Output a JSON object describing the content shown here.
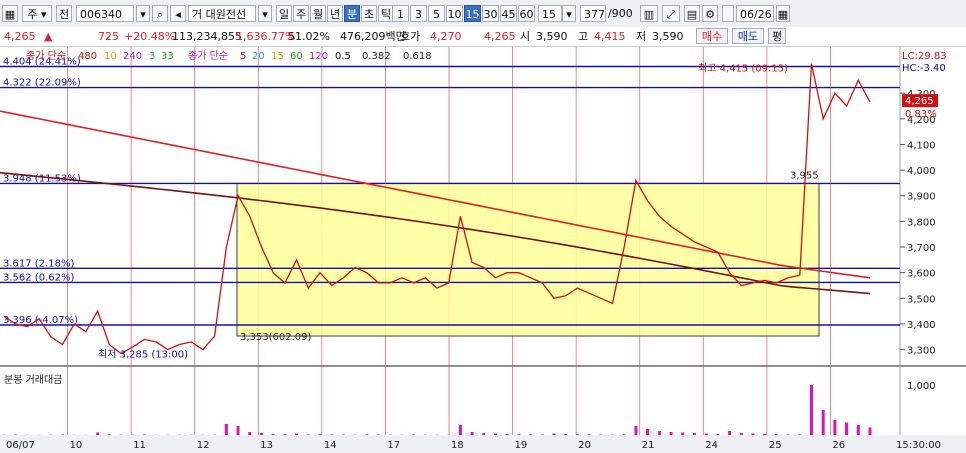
{
  "toolbar": {
    "mode_select": "주",
    "market_select": "전",
    "code": "006340",
    "name": "거 대원전선",
    "period_tabs": [
      "일",
      "주",
      "월",
      "년",
      "분",
      "초",
      "틱"
    ],
    "active_period": "분",
    "intervals": [
      "1",
      "3",
      "5",
      "10",
      "15",
      "30",
      "45",
      "60"
    ],
    "active_interval": "15",
    "interval_input": "15",
    "count": "377",
    "count_total": "/900",
    "date": "06/26"
  },
  "quote": {
    "price": "4,265",
    "arrow": "▲",
    "change": "725",
    "change_pct": "+20.48%",
    "volume": "113,234,855",
    "volume_ratio": "1,636.77%",
    "turnover": "51.02%",
    "amount": "476,209백만",
    "hoga_label": "호가",
    "hoga_ask": "4,270",
    "hoga_bid": "4,265",
    "open_label": "시",
    "open": "3,590",
    "high_label": "고",
    "high": "4,415",
    "low_label": "저",
    "low": "3,590",
    "buy_button": "매수",
    "sell_button": "매도",
    "eval_button": "평"
  },
  "legend": {
    "price_ma_label": "종가 단순",
    "price_ma_periods": [
      "480",
      "10",
      "240",
      "3",
      "33"
    ],
    "volume_ma_label": "종가 단순",
    "volume_ma_periods": [
      "5",
      "20",
      "15",
      "60",
      "120"
    ],
    "fib_values": [
      "0.5",
      "0.382",
      "0.618"
    ],
    "lc_label": "LC:29.83",
    "hc_label": "HC:-3.40"
  },
  "annotations": {
    "level_labels": [
      "4.404 (24.41%)",
      "4.322 (22.09%)",
      "3.948 (11.53%)",
      "3.617 (2.18%)",
      "3.562 (0.62%)",
      "3.396 (-4.07%)"
    ],
    "high_mark": "최고 4,415 (09:15)",
    "low_mark": "최저 3,285 (13:00)",
    "base_mark": "3,353(602.09)",
    "box_top_mark": "3,955",
    "current_price_tag": "4,265",
    "current_pct_tag": "0.83%"
  },
  "volume_pane": {
    "title": "분봉 거래대금",
    "axis_label": "1,000"
  },
  "colors": {
    "price_line": "#d01010",
    "ma_long": "#e02020",
    "ma_long2": "#7a1010",
    "hline": "#1010b0",
    "box_fill": "#ffff99",
    "volume_bar": "#e010c0",
    "grid_vline": "#e03030"
  },
  "chart_data": {
    "type": "line",
    "title": "",
    "x_ticks": [
      "06/07",
      "10",
      "11",
      "12",
      "13",
      "14",
      "17",
      "18",
      "19",
      "20",
      "21",
      "24",
      "25",
      "26",
      "15:30:00"
    ],
    "y_ticks": [
      4300,
      4200,
      4100,
      4000,
      3900,
      3800,
      3700,
      3600,
      3500,
      3400,
      3300
    ],
    "ylim": [
      3240,
      4480
    ],
    "horizontal_levels": [
      4404,
      4322,
      3948,
      3617,
      3562,
      3396
    ],
    "series": [
      {
        "values": [
          3430,
          3400,
          3390,
          3420,
          3350,
          3320,
          3400,
          3370,
          3450,
          3320,
          3285,
          3310,
          3340,
          3330,
          3300,
          3320,
          3330,
          3300,
          3353,
          3700,
          3900,
          3820,
          3700,
          3600,
          3560,
          3650,
          3540,
          3600,
          3550,
          3580,
          3620,
          3600,
          3560,
          3560,
          3580,
          3560,
          3580,
          3540,
          3560,
          3820,
          3640,
          3620,
          3580,
          3600,
          3600,
          3580,
          3560,
          3500,
          3510,
          3540,
          3520,
          3500,
          3480,
          3700,
          3960,
          3880,
          3820,
          3780,
          3750,
          3720,
          3700,
          3680,
          3600,
          3550,
          3560,
          3570,
          3560,
          3580,
          3590,
          4415,
          4200,
          4300,
          4250,
          4350,
          4265
        ],
        "y_min": 3285,
        "y_max": 4415
      }
    ],
    "volume_ylim": [
      0,
      1200
    ],
    "volume_values": [
      5,
      8,
      4,
      3,
      6,
      10,
      4,
      3,
      50,
      12,
      6,
      5,
      8,
      4,
      3,
      5,
      6,
      4,
      5,
      220,
      180,
      60,
      40,
      20,
      15,
      30,
      12,
      10,
      10,
      8,
      6,
      12,
      8,
      6,
      5,
      8,
      6,
      5,
      4,
      200,
      60,
      40,
      30,
      20,
      15,
      12,
      10,
      30,
      20,
      15,
      10,
      8,
      6,
      12,
      180,
      120,
      80,
      60,
      50,
      40,
      30,
      20,
      80,
      40,
      30,
      20,
      15,
      12,
      10,
      1000,
      500,
      300,
      250,
      200,
      150
    ]
  }
}
